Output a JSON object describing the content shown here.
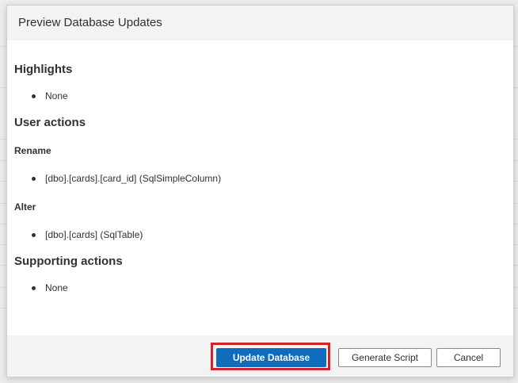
{
  "dialog": {
    "title": "Preview Database Updates"
  },
  "sections": {
    "highlights": {
      "heading": "Highlights",
      "items": [
        "None"
      ]
    },
    "user_actions": {
      "heading": "User actions",
      "rename": {
        "heading": "Rename",
        "items": [
          "[dbo].[cards].[card_id] (SqlSimpleColumn)"
        ]
      },
      "alter": {
        "heading": "Alter",
        "items": [
          "[dbo].[cards] (SqlTable)"
        ]
      }
    },
    "supporting_actions": {
      "heading": "Supporting actions",
      "items": [
        "None"
      ]
    }
  },
  "footer": {
    "update_label": "Update Database",
    "generate_label": "Generate Script",
    "cancel_label": "Cancel"
  },
  "colors": {
    "primary": "#0f6cbd",
    "highlight_border": "#d1232a",
    "header_bg": "#f3f3f3"
  }
}
